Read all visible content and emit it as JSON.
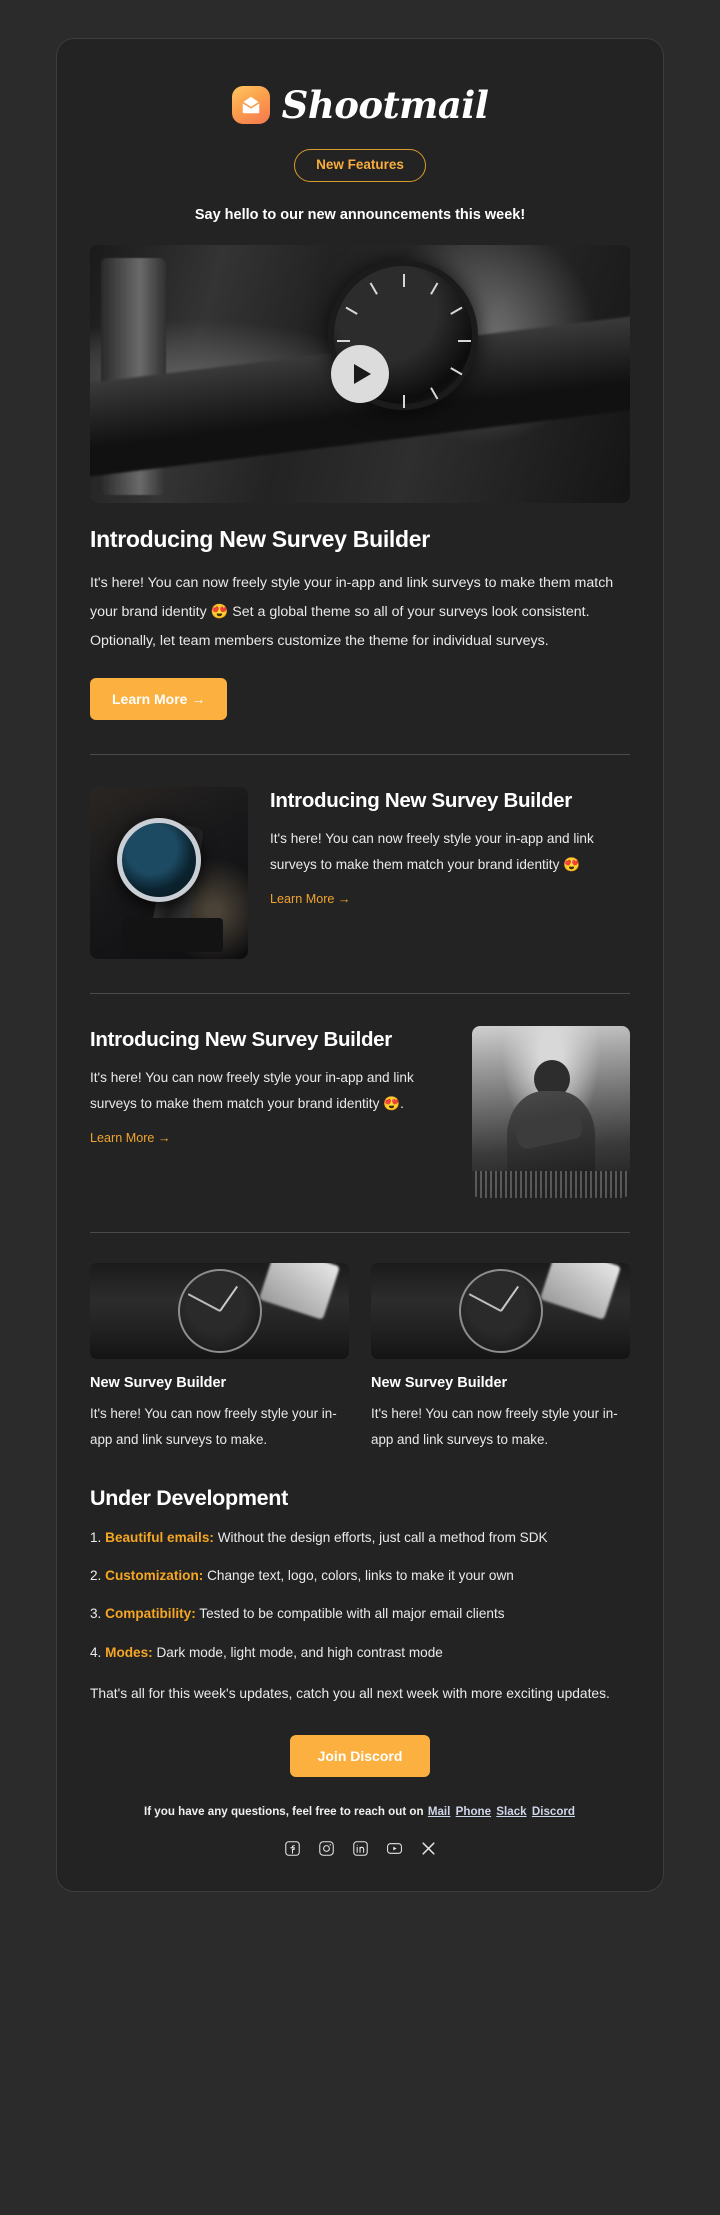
{
  "brand": {
    "name": "Shootmail",
    "logo_icon": "envelope-icon",
    "logo_gradient": [
      "#ffc661",
      "#f4764f"
    ]
  },
  "header": {
    "badge_label": "New Features",
    "badge_color": "#f9ad3c",
    "tagline": "Say hello to our new announcements this week!"
  },
  "hero": {
    "media_type": "video-thumbnail",
    "play_icon": "play-icon",
    "alt": "black wristwatch on dark surface"
  },
  "feature_main": {
    "title": "Introducing New Survey Builder",
    "body": "It's here! You can now freely style your in-app and link surveys to make them match your brand identity 😍 Set a global theme so all of your surveys look consistent. Optionally, let team members customize the theme for individual surveys.",
    "cta_label": "Learn More →",
    "cta_color": "#fbb03f"
  },
  "feature_left_image": {
    "title": "Introducing New Survey Builder",
    "body": "It's here! You can now freely style your in-app and link surveys to make them match your brand identity 😍",
    "link_label": "Learn More →",
    "image_alt": "blue-dial chronograph watch on stand"
  },
  "feature_right_image": {
    "title": "Introducing New Survey Builder",
    "body": "It's here! You can now freely style your in-app and link surveys to make them match your brand identity 😍.",
    "link_label": "Learn More →",
    "image_alt": "man checking wristwatch outdoors black and white"
  },
  "cards": [
    {
      "title": "New Survey Builder",
      "body": "It's here! You can now freely style your in-app and link surveys to make.",
      "image_alt": "close-up of wristwatch face on wrist"
    },
    {
      "title": "New Survey Builder",
      "body": "It's here! You can now freely style your in-app and link surveys to make.",
      "image_alt": "close-up of wristwatch face on wrist"
    }
  ],
  "under_development": {
    "title": "Under Development",
    "items": [
      {
        "num": "1.",
        "keyword": "Beautiful emails:",
        "text": "Without the design efforts, just call a method from SDK"
      },
      {
        "num": "2.",
        "keyword": "Customization:",
        "text": "Change text, logo, colors, links to make it your own"
      },
      {
        "num": "3.",
        "keyword": "Compatibility:",
        "text": "Tested to be compatible with all major email clients"
      },
      {
        "num": "4.",
        "keyword": "Modes:",
        "text": "Dark mode, light mode, and high contrast mode"
      }
    ],
    "keyword_color": "#f5a623"
  },
  "outro": "That's all for this week's updates, catch you all next week with more exciting updates.",
  "discord": {
    "label": "Join Discord"
  },
  "footer": {
    "note_prefix": "If you have any questions, feel free to reach out on",
    "links": [
      "Mail",
      "Phone",
      "Slack",
      "Discord"
    ],
    "socials": [
      {
        "name": "facebook-icon",
        "label": "Facebook"
      },
      {
        "name": "instagram-icon",
        "label": "Instagram"
      },
      {
        "name": "linkedin-icon",
        "label": "LinkedIn"
      },
      {
        "name": "youtube-icon",
        "label": "YouTube"
      },
      {
        "name": "x-icon",
        "label": "X"
      }
    ]
  }
}
